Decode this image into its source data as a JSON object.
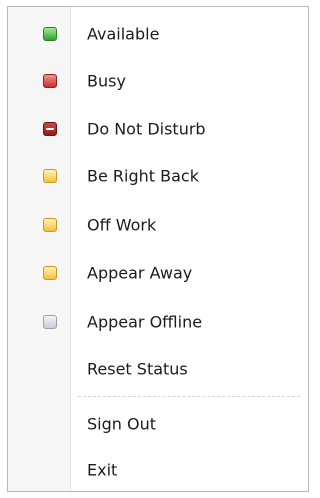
{
  "menu": {
    "items": [
      {
        "label": "Available",
        "icon": "available-icon",
        "color": "#32a832"
      },
      {
        "label": "Busy",
        "icon": "busy-icon",
        "color": "#d13a34"
      },
      {
        "label": "Do Not Disturb",
        "icon": "do-not-disturb-icon",
        "color": "#9b2320"
      },
      {
        "label": "Be Right Back",
        "icon": "away-icon",
        "color": "#f0c040"
      },
      {
        "label": "Off Work",
        "icon": "away-icon",
        "color": "#f0c040"
      },
      {
        "label": "Appear Away",
        "icon": "away-icon",
        "color": "#f0c040"
      },
      {
        "label": "Appear Offline",
        "icon": "offline-icon",
        "color": "#c9ccd6"
      },
      {
        "label": "Reset Status",
        "icon": "",
        "color": ""
      }
    ],
    "footer_items": [
      {
        "label": "Sign Out"
      },
      {
        "label": "Exit"
      }
    ]
  }
}
